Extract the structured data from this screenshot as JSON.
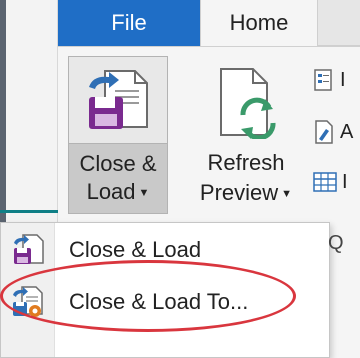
{
  "tabs": {
    "file": "File",
    "home": "Home"
  },
  "ribbon": {
    "close_load": {
      "line1": "Close &",
      "line2": "Load",
      "icon": "close-load-icon"
    },
    "refresh_preview": {
      "line1": "Refresh",
      "line2": "Preview",
      "icon": "refresh-preview-icon"
    },
    "small_buttons": [
      {
        "label": "I",
        "icon": "properties-icon"
      },
      {
        "label": "A",
        "icon": "advanced-editor-icon"
      },
      {
        "label": "I",
        "icon": "manage-icon"
      }
    ]
  },
  "menu": {
    "items": [
      {
        "label": "Close & Load",
        "icon": "close-load-small-icon"
      },
      {
        "label": "Close & Load To...",
        "icon": "close-load-to-icon"
      }
    ],
    "cut_group_label": "Q"
  },
  "colors": {
    "file_tab": "#1f6ec6",
    "annotation": "#d9363e",
    "disk_purple": "#7a2a8f",
    "arrow_blue": "#2f6fb5",
    "refresh_green": "#3a9a6a"
  }
}
